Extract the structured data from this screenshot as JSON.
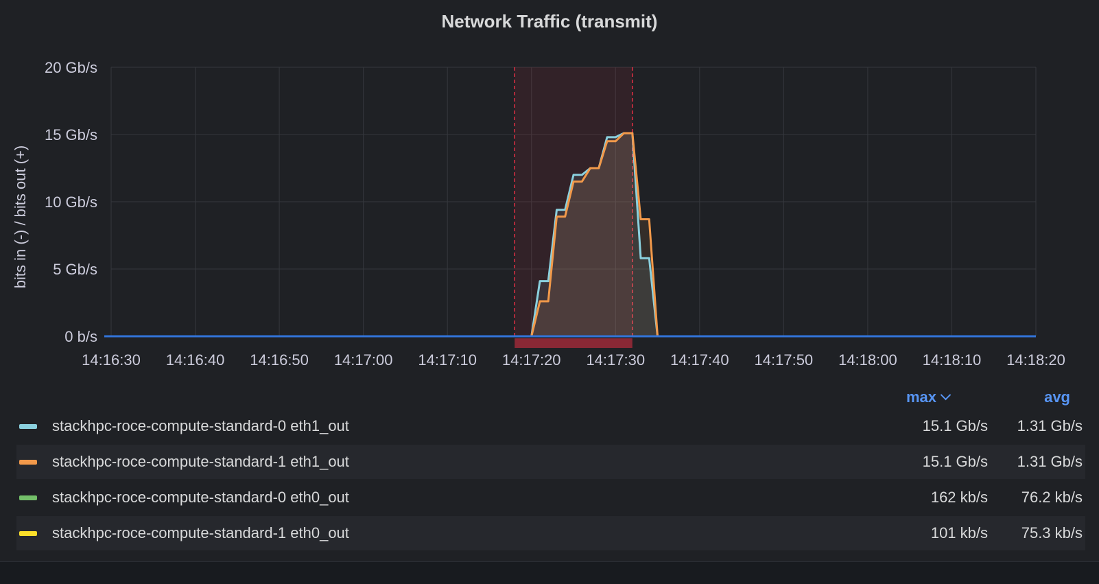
{
  "chart_data": {
    "type": "line",
    "title": "Network Traffic (transmit)",
    "ylabel": "bits in (-) / bits out (+)",
    "xlabel": "",
    "y_unit": "Gb/s",
    "ylim": [
      0,
      20
    ],
    "y_ticks": [
      {
        "value": 0,
        "label": "0 b/s"
      },
      {
        "value": 5,
        "label": "5 Gb/s"
      },
      {
        "value": 10,
        "label": "10 Gb/s"
      },
      {
        "value": 15,
        "label": "15 Gb/s"
      },
      {
        "value": 20,
        "label": "20 Gb/s"
      }
    ],
    "xlim": [
      "14:16:30",
      "14:18:20"
    ],
    "x_ticks": [
      "14:16:30",
      "14:16:40",
      "14:16:50",
      "14:17:00",
      "14:17:10",
      "14:17:20",
      "14:17:30",
      "14:17:40",
      "14:17:50",
      "14:18:00",
      "14:18:10",
      "14:18:20"
    ],
    "grid": true,
    "annotation_region": {
      "start": "14:17:18",
      "end": "14:17:32",
      "color": "#e02f44"
    },
    "series": [
      {
        "name": "stackhpc-roce-compute-standard-0 eth1_out",
        "color": "#8ad0de",
        "points": [
          [
            "14:16:30",
            0
          ],
          [
            "14:17:20",
            0
          ],
          [
            "14:17:21",
            4.1
          ],
          [
            "14:17:22",
            4.1
          ],
          [
            "14:17:23",
            9.4
          ],
          [
            "14:17:24",
            9.4
          ],
          [
            "14:17:25",
            12.0
          ],
          [
            "14:17:26",
            12.0
          ],
          [
            "14:17:27",
            12.5
          ],
          [
            "14:17:28",
            12.5
          ],
          [
            "14:17:29",
            14.8
          ],
          [
            "14:17:30",
            14.8
          ],
          [
            "14:17:31",
            15.1
          ],
          [
            "14:17:32",
            15.1
          ],
          [
            "14:17:33",
            5.8
          ],
          [
            "14:17:34",
            5.8
          ],
          [
            "14:17:35",
            0
          ],
          [
            "14:18:20",
            0
          ]
        ],
        "max": "15.1 Gb/s",
        "avg": "1.31 Gb/s"
      },
      {
        "name": "stackhpc-roce-compute-standard-1 eth1_out",
        "color": "#f2994a",
        "points": [
          [
            "14:16:30",
            0
          ],
          [
            "14:17:20",
            0
          ],
          [
            "14:17:21",
            2.6
          ],
          [
            "14:17:22",
            2.6
          ],
          [
            "14:17:23",
            8.9
          ],
          [
            "14:17:24",
            8.9
          ],
          [
            "14:17:25",
            11.5
          ],
          [
            "14:17:26",
            11.5
          ],
          [
            "14:17:27",
            12.5
          ],
          [
            "14:17:28",
            12.5
          ],
          [
            "14:17:29",
            14.5
          ],
          [
            "14:17:30",
            14.5
          ],
          [
            "14:17:31",
            15.1
          ],
          [
            "14:17:32",
            15.1
          ],
          [
            "14:17:33",
            8.7
          ],
          [
            "14:17:34",
            8.7
          ],
          [
            "14:17:35",
            0
          ],
          [
            "14:18:20",
            0
          ]
        ],
        "max": "15.1 Gb/s",
        "avg": "1.31 Gb/s"
      },
      {
        "name": "stackhpc-roce-compute-standard-0 eth0_out",
        "color": "#73bf69",
        "points": [
          [
            "14:16:30",
            0
          ],
          [
            "14:18:20",
            0
          ]
        ],
        "max": "162 kb/s",
        "avg": "76.2 kb/s"
      },
      {
        "name": "stackhpc-roce-compute-standard-1 eth0_out",
        "color": "#fade2a",
        "points": [
          [
            "14:16:30",
            0
          ],
          [
            "14:18:20",
            0
          ]
        ],
        "max": "101 kb/s",
        "avg": "75.3 kb/s"
      }
    ],
    "baseline_color": "#3274d9"
  },
  "legend": {
    "max_label": "max",
    "avg_label": "avg",
    "rows": [
      {
        "name": "stackhpc-roce-compute-standard-0 eth1_out",
        "color": "#8ad0de",
        "max": "15.1 Gb/s",
        "avg": "1.31 Gb/s"
      },
      {
        "name": "stackhpc-roce-compute-standard-1 eth1_out",
        "color": "#f2994a",
        "max": "15.1 Gb/s",
        "avg": "1.31 Gb/s"
      },
      {
        "name": "stackhpc-roce-compute-standard-0 eth0_out",
        "color": "#73bf69",
        "max": "162 kb/s",
        "avg": "76.2 kb/s"
      },
      {
        "name": "stackhpc-roce-compute-standard-1 eth0_out",
        "color": "#fade2a",
        "max": "101 kb/s",
        "avg": "75.3 kb/s"
      }
    ]
  }
}
